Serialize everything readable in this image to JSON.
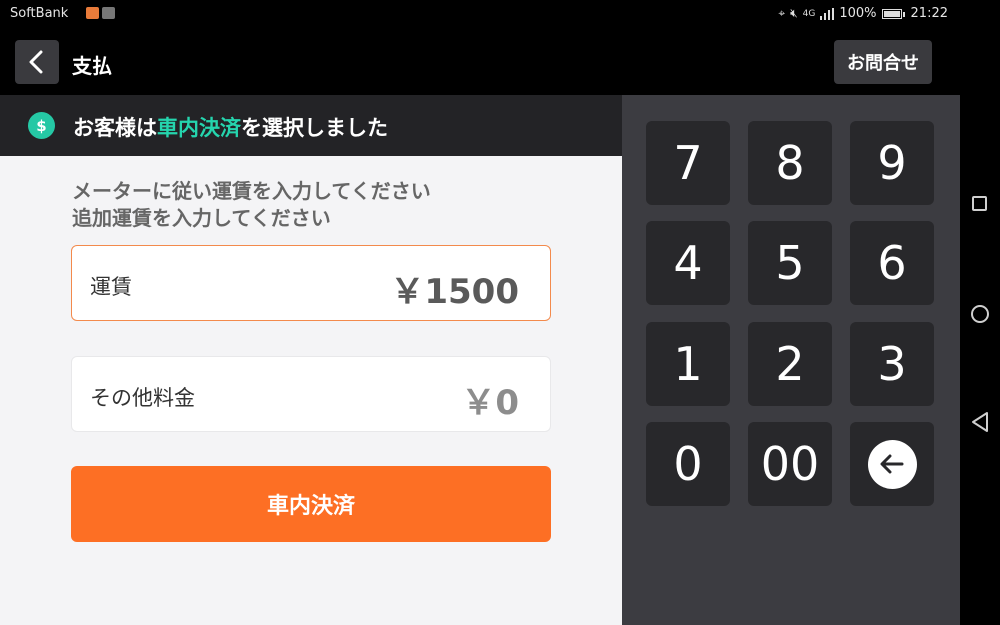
{
  "status_bar": {
    "carrier": "SoftBank",
    "network": "4G",
    "battery": "100%",
    "time": "21:22",
    "icons": [
      "location-icon",
      "mute-icon",
      "signal-icon",
      "battery-icon"
    ]
  },
  "header": {
    "title": "支払",
    "contact_label": "お問合せ"
  },
  "banner": {
    "icon": "$",
    "text_before": "お客様は",
    "text_highlight": "車内決済",
    "text_after": "を選択しました",
    "highlight_color": "#25d5ae"
  },
  "instructions": {
    "line1": "メーターに従い運賃を入力してください",
    "line2": "追加運賃を入力してください"
  },
  "fare": {
    "label": "運賃",
    "value": "￥1500"
  },
  "other_fee": {
    "label": "その他料金",
    "value": "￥0"
  },
  "pay_button_label": "車内決済",
  "keypad": {
    "keys": [
      "7",
      "8",
      "9",
      "4",
      "5",
      "6",
      "1",
      "2",
      "3",
      "0",
      "00"
    ],
    "backspace_icon": "backspace-arrow-icon"
  },
  "colors": {
    "accent_orange": "#fd6f24",
    "accent_teal": "#25c8a5",
    "keypad_bg": "#3c3c41",
    "key_bg": "#28282b"
  }
}
